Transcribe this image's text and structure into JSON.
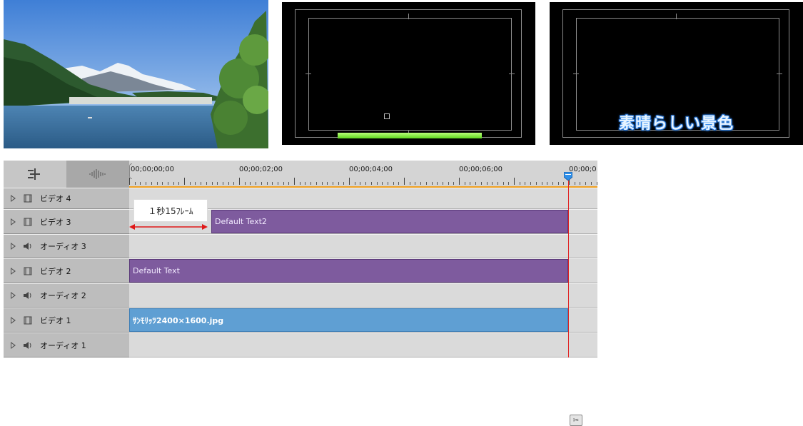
{
  "timeline": {
    "ruler_labels": [
      "00;00;00;00",
      "00;00;02;00",
      "00;00;04;00",
      "00;00;06;00",
      "00;00;0"
    ],
    "tracks": [
      {
        "type": "video",
        "label": "ビデオ 4"
      },
      {
        "type": "video",
        "label": "ビデオ 3"
      },
      {
        "type": "audio",
        "label": "オーディオ 3"
      },
      {
        "type": "video",
        "label": "ビデオ 2"
      },
      {
        "type": "audio",
        "label": "オーディオ 2"
      },
      {
        "type": "video",
        "label": "ビデオ 1"
      },
      {
        "type": "audio",
        "label": "オーディオ 1"
      }
    ],
    "clips": {
      "video3": "Default Text2",
      "video2": "Default Text",
      "video1": "ｻﾝﾓﾘｯﾂ2400×1600.jpg"
    }
  },
  "annotation": {
    "duration_label": "１秒15ﾌﾚｰﾑ"
  },
  "preview": {
    "title_text": "素晴らしい景色"
  },
  "colors": {
    "clip_text": "#7e5b9e",
    "clip_image": "#5f9fd3",
    "playhead": "#e02020",
    "ruler_accent": "#f0a020"
  }
}
